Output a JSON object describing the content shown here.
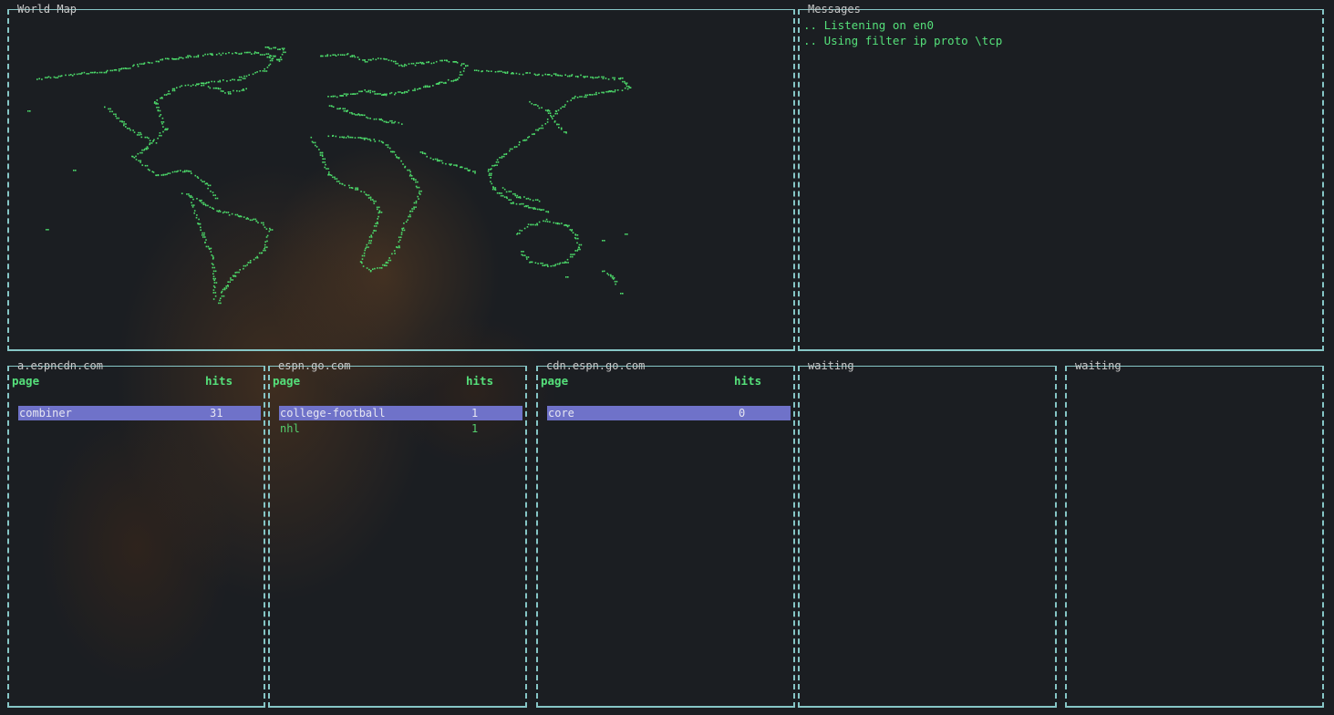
{
  "world_map": {
    "title": "World Map"
  },
  "messages": {
    "title": "Messages",
    "lines": [
      ".. Listening on en0",
      ".. Using filter ip proto \\tcp"
    ]
  },
  "hosts": [
    {
      "title": "a.espncdn.com",
      "col_page": "page",
      "col_hits": "hits",
      "rows": [
        {
          "page": "combiner",
          "hits": "31",
          "selected": true
        }
      ]
    },
    {
      "title": "espn.go.com",
      "col_page": "page",
      "col_hits": "hits",
      "rows": [
        {
          "page": "college-football",
          "hits": "1",
          "selected": true
        },
        {
          "page": "nhl",
          "hits": "1",
          "selected": false
        }
      ]
    },
    {
      "title": "cdn.espn.go.com",
      "col_page": "page",
      "col_hits": "hits",
      "rows": [
        {
          "page": "core",
          "hits": "0",
          "selected": true
        }
      ]
    },
    {
      "title": "waiting"
    },
    {
      "title": "waiting"
    }
  ],
  "colors": {
    "border": "#86c6c6",
    "header_text": "#55e07a",
    "selected_row": "#6f72c9",
    "map_dots": "#4ddc6b"
  }
}
